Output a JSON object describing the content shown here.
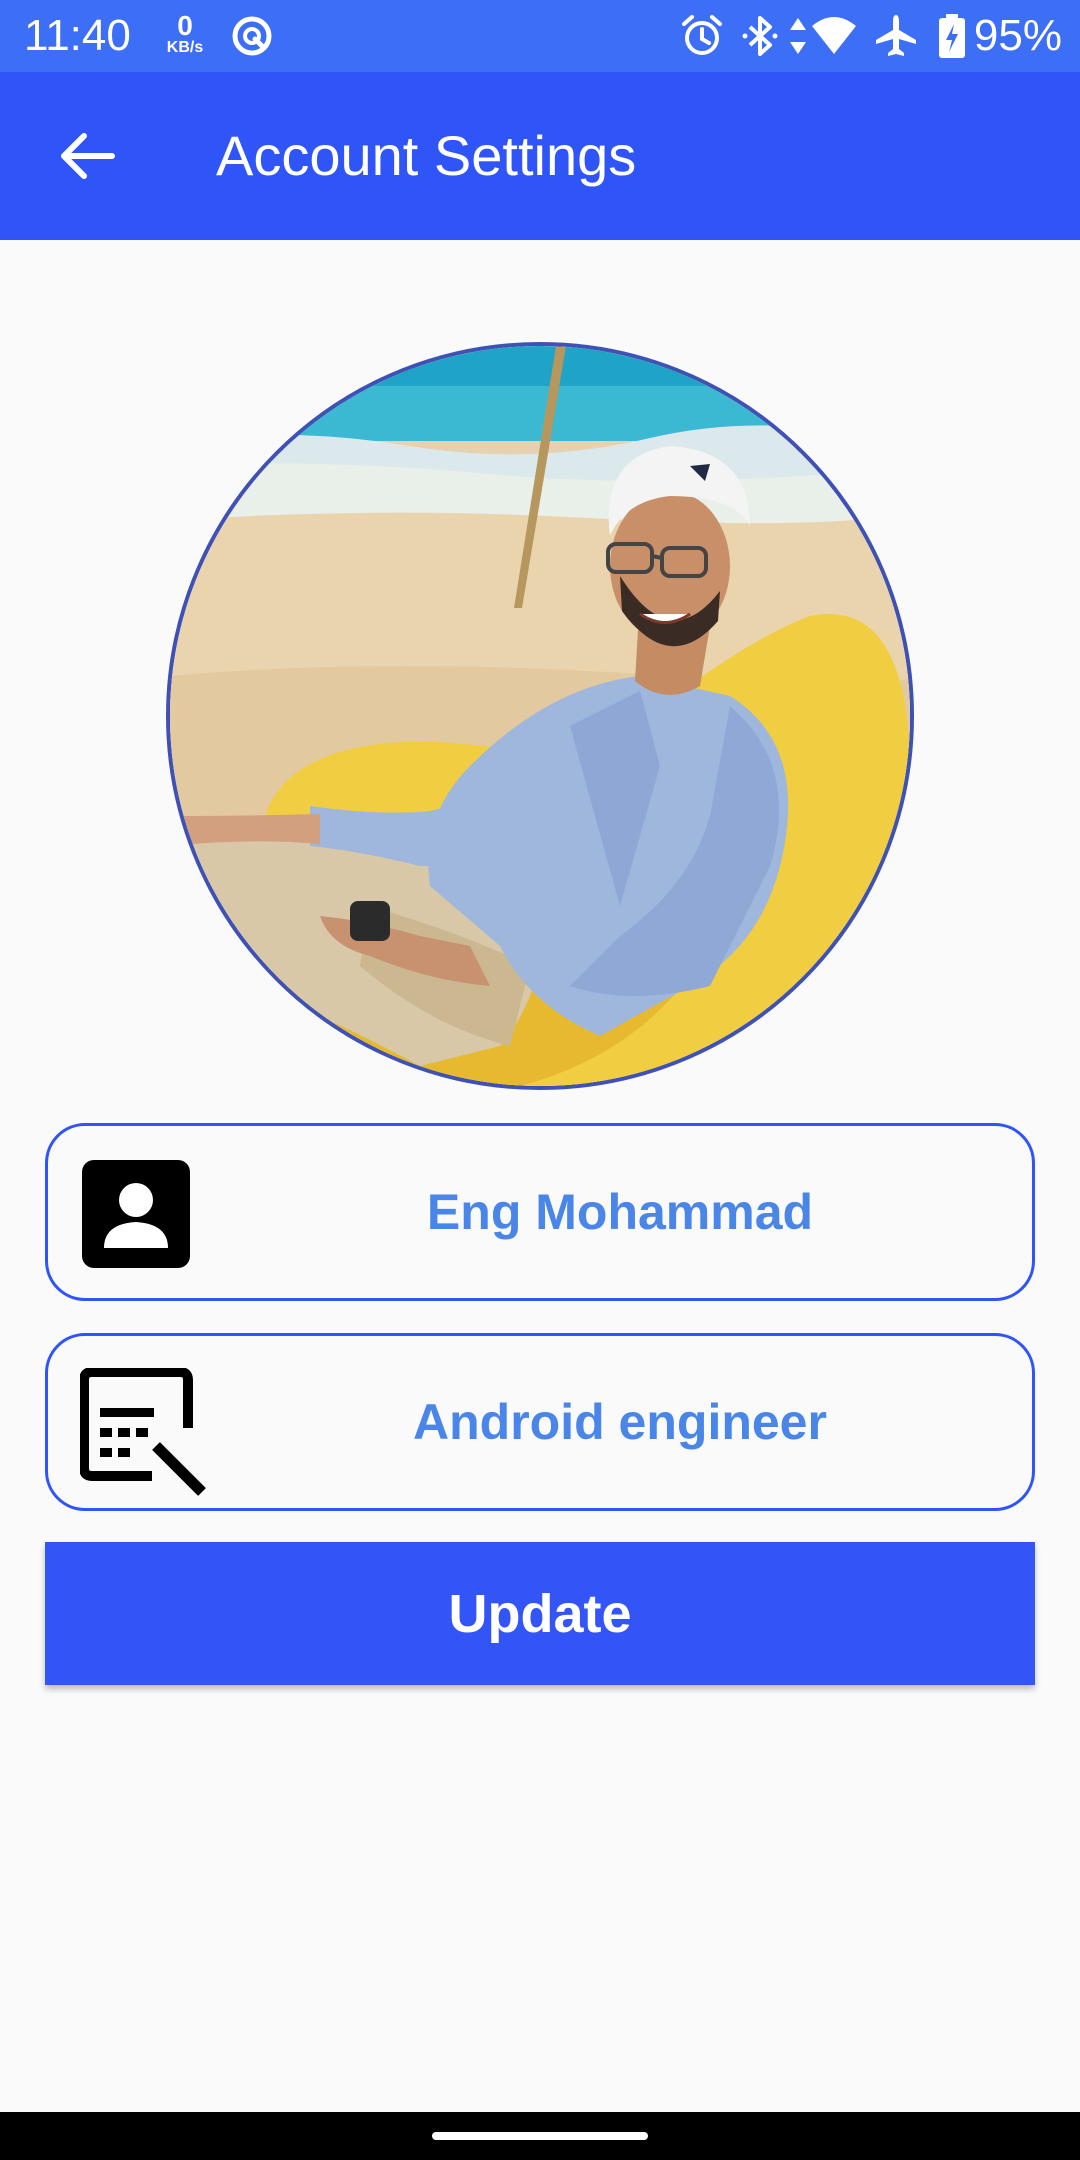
{
  "status_bar": {
    "time": "11:40",
    "network_speed_value": "0",
    "network_speed_unit": "KB/s",
    "battery_percent": "95%",
    "icons": [
      "data-saver-icon",
      "alarm-icon",
      "bluetooth-icon",
      "data-arrows-icon",
      "wifi-icon",
      "airplane-icon",
      "battery-charging-icon"
    ]
  },
  "app_bar": {
    "title": "Account Settings",
    "back_icon": "arrow-back-icon"
  },
  "profile": {
    "photo": "profile-photo",
    "name": "Eng Mohammad",
    "name_icon": "contact-card-icon",
    "job_title": "Android engineer",
    "job_icon": "edit-text-icon"
  },
  "actions": {
    "update_label": "Update"
  },
  "colors": {
    "status_bar": "#3d6ef6",
    "app_bar": "#2f54f7",
    "field_border": "#2f54f7",
    "field_text": "#4a86e8",
    "button": "#3355f8",
    "avatar_border": "#3f51b5",
    "background": "#fafafa"
  }
}
